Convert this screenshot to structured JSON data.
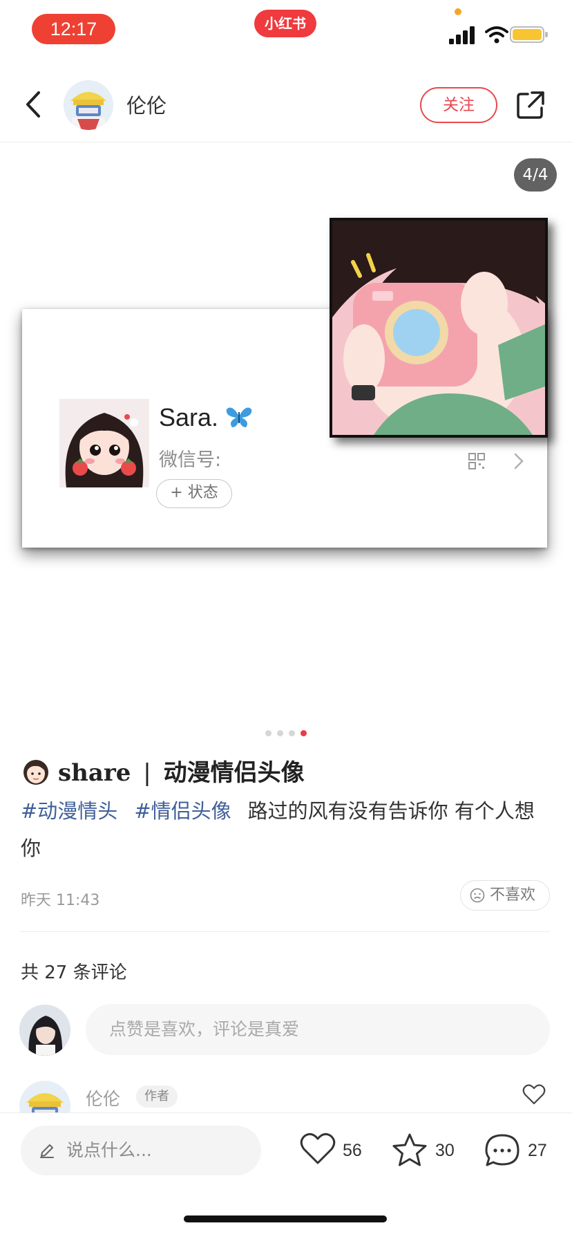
{
  "status_bar": {
    "time": "12:17",
    "app_badge": "小红书"
  },
  "header": {
    "author_name": "伦伦",
    "follow_label": "关注"
  },
  "media": {
    "page_indicator": "4/4",
    "card": {
      "name": "Sara.",
      "wechat_label": "微信号:",
      "status_label": "+ 状态"
    },
    "pager": {
      "total": 4,
      "active_index": 3
    }
  },
  "post": {
    "title_prefix": "share",
    "title_separator": "|",
    "title_text": "动漫情侣头像",
    "tags": [
      "#动漫情头",
      "#情侣头像"
    ],
    "body": "路过的风有没有告诉你 有个人想你",
    "time": "昨天 11:43",
    "dislike_label": "不喜欢"
  },
  "comments": {
    "count_label": "共 27 条评论",
    "input_placeholder": "点赞是喜欢，评论是真爱",
    "first": {
      "name": "伦伦",
      "badge": "作者"
    }
  },
  "bottom_bar": {
    "say_placeholder": "说点什么...",
    "likes": "56",
    "stars": "30",
    "comments": "27"
  },
  "colors": {
    "brand_red": "#ef3a3e",
    "tag_blue": "#3f5f99"
  },
  "icons": [
    "back-icon",
    "share-out-icon",
    "qr-code-icon",
    "chevron-right-icon",
    "sad-face-icon",
    "heart-icon",
    "star-icon",
    "comment-bubble-icon",
    "pen-icon",
    "signal-icon",
    "wifi-icon",
    "battery-icon"
  ]
}
